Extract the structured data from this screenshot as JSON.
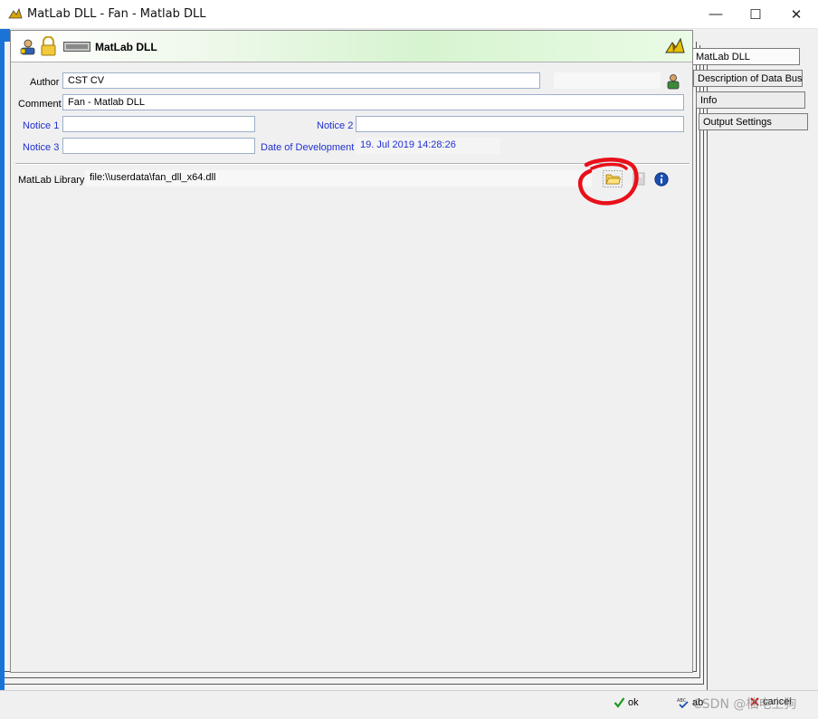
{
  "window": {
    "title": "MatLab DLL - Fan - Matlab DLL",
    "minimize": "—",
    "maximize": "☐",
    "close": "✕"
  },
  "header": {
    "title": "MatLab DLL"
  },
  "form": {
    "author_label": "Author",
    "author_value": "CST CV",
    "comment_label": "Comment",
    "comment_value": "Fan - Matlab DLL",
    "notice1_label": "Notice 1",
    "notice1_value": "",
    "notice2_label": "Notice 2",
    "notice2_value": "",
    "notice3_label": "Notice 3",
    "notice3_value": "",
    "date_label": "Date of Development",
    "date_value": "19. Jul 2019 14:28:26",
    "library_label": "MatLab Library",
    "library_value": "file:\\\\userdata\\fan_dll_x64.dll"
  },
  "tabs": [
    {
      "label": "MatLab DLL",
      "active": true
    },
    {
      "label": "Description of Data Bus",
      "active": false
    },
    {
      "label": "Info",
      "active": false
    },
    {
      "label": "Output Settings",
      "active": false
    }
  ],
  "footer": {
    "ok_label": "ok",
    "second_label": "ab",
    "cancel_label": "cancel"
  },
  "watermark": "CSDN @柚电上狗",
  "colors": {
    "accent_blue": "#1a74d8",
    "label_blue": "#2030d0",
    "header_green": "#d6f4cf",
    "annotation_red": "#e8101a"
  }
}
